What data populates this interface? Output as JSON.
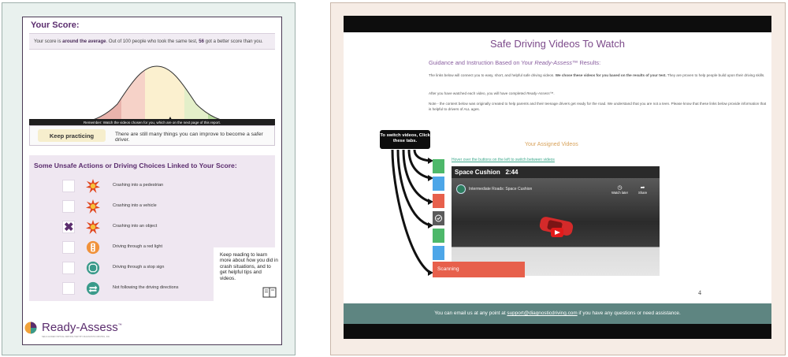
{
  "left_page": {
    "score_title": "Your Score:",
    "score_text_1": "Your score is ",
    "score_text_bold": "around the average",
    "score_text_2": ". Out of 100 people who took the same test, ",
    "score_number": "56",
    "score_text_3": " got a better score than you.",
    "remember_text": "Remember: Watch the videos chosen for you, which are on the next page of this report.",
    "feedback_label": "Keep practicing",
    "feedback_text": "There are still many things you can improve to become a safer driver.",
    "unsafe_title": "Some Unsafe Actions or Driving Choices Linked to Your Score:",
    "unsafe_items": [
      {
        "label": "Crashing into a pedestrian",
        "checked": false,
        "icon": "crash-burst-icon"
      },
      {
        "label": "Crashing into a vehicle",
        "checked": false,
        "icon": "crash-burst-icon"
      },
      {
        "label": "Crashing into an object",
        "checked": true,
        "icon": "crash-burst-icon"
      },
      {
        "label": "Driving through a red light",
        "checked": false,
        "icon": "traffic-light-icon"
      },
      {
        "label": "Driving through a stop sign",
        "checked": false,
        "icon": "stop-sign-icon"
      },
      {
        "label": "Not following the driving directions",
        "checked": false,
        "icon": "directions-icon"
      }
    ],
    "checked_mark": "✖",
    "tips_text": "Keep reading to learn more about how you did in crash situations, and to get helpful tips and videos.",
    "logo_text": "Ready-Assess",
    "logo_tm": "™",
    "logo_tagline": "SELF-GUIDED VIRTUAL DRIVING TEST BY DIAGNOSTIC DRIVING, INC.",
    "colors": {
      "brand_purple": "#5b2d6e",
      "curve_red": "#c0392b",
      "curve_yellow": "#f6eecd",
      "curve_green": "#a9d18e"
    }
  },
  "right_page": {
    "title": "Safe Driving Videos To Watch",
    "guidance_prefix": "Guidance and Instruction Based on Your ",
    "guidance_brand": "Ready-Assess",
    "guidance_suffix": "™ Results:",
    "para1_a": "The links below will connect you to easy, short, and helpful safe driving videos. ",
    "para1_b": "We chose these videos for you based on the results of your test.",
    "para1_c": " They are proven to help people build upon their driving skills.",
    "para2_a": "After you have watched each video, you will have completed ",
    "para2_b": "Ready-Assess",
    "para2_c": "™.",
    "para3": "Note - the content below was originally created to help parents and their teenage drivers get ready for the road. We understand that you are not a teen. Please know that these links below provide information that is helpful to drivers of ALL ages.",
    "assigned_title": "Your Assigned Videos",
    "hover_link": "Hover over the buttons on the left to switch between videos",
    "callout": "To switch videos, Click these tabs.",
    "video_title": "Space Cushion",
    "video_duration": "2:44",
    "channel_title": "Intermediate Roads: Space Cushion",
    "watch_later": "Watch later",
    "share": "Share",
    "active_tab_label": "Scanning",
    "page_number": "4",
    "contact_prefix": "You can email us at any point at ",
    "contact_email": "support@diagnosticdriving.com",
    "contact_suffix": " if you have any questions or need assistance.",
    "tab_colors": [
      "#4db86a",
      "#4da6e8",
      "#e7604c",
      "#5b5b5b",
      "#4db86a",
      "#4da6e8"
    ],
    "colors": {
      "title_purple": "#7c4a8a",
      "assigned_gold": "#d8a25a",
      "link_green": "#3fa98d",
      "footer_teal": "#5e8581",
      "scanning_red": "#e7604c"
    }
  }
}
